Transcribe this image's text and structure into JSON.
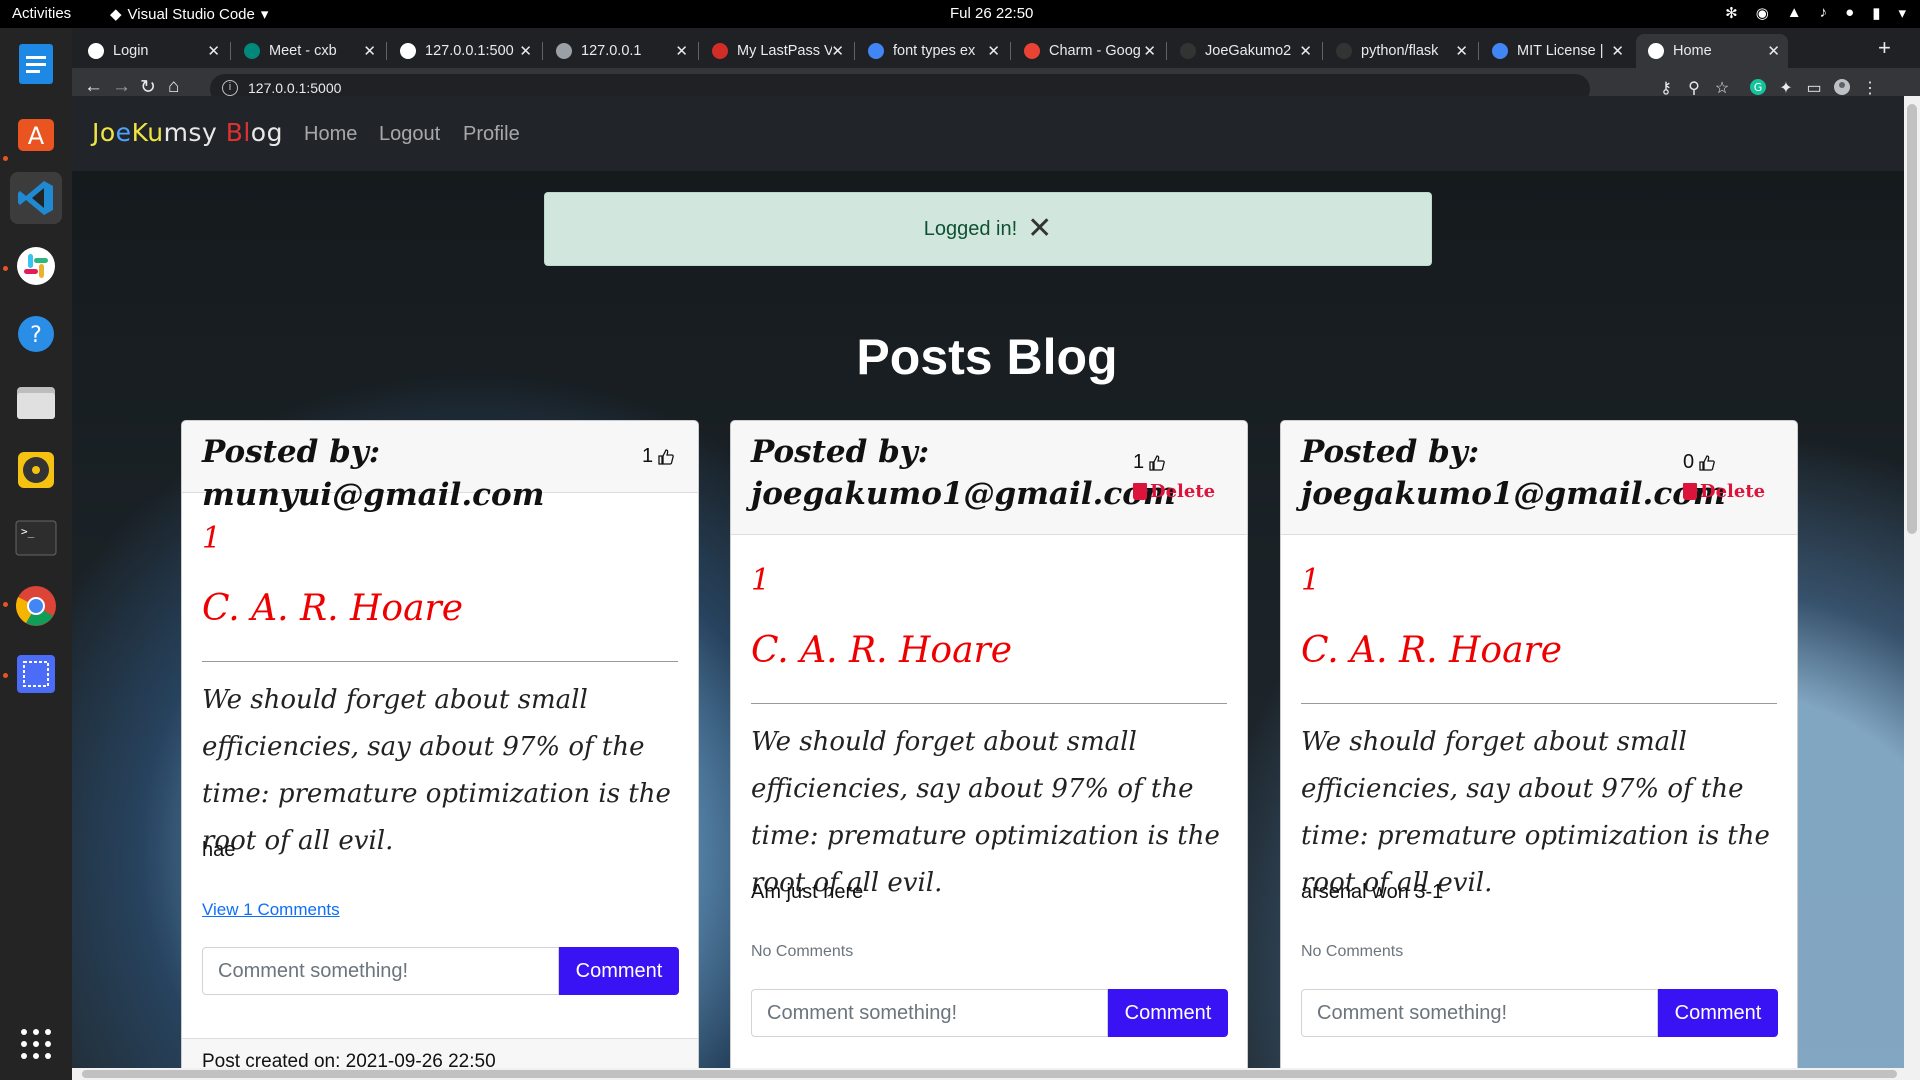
{
  "system": {
    "activities": "Activities",
    "app_menu": "Visual Studio Code",
    "clock": "Ful 26  22:50"
  },
  "browser": {
    "tabs": [
      {
        "label": "Login",
        "fav": "globe-icon",
        "color": "#ffffff"
      },
      {
        "label": "Meet - cxb",
        "fav": "meet-icon",
        "color": "#00897b"
      },
      {
        "label": "127.0.0.1:500",
        "fav": "globe-icon",
        "color": "#ffffff"
      },
      {
        "label": "127.0.0.1",
        "fav": "globe-icon",
        "color": "#9aa0a6"
      },
      {
        "label": "My LastPass V",
        "fav": "lastpass-icon",
        "color": "#d32d27"
      },
      {
        "label": "font types ex",
        "fav": "google-icon",
        "color": "#4285f4"
      },
      {
        "label": "Charm - Goog",
        "fav": "google-fonts-icon",
        "color": "#ea4335"
      },
      {
        "label": "JoeGakumo2",
        "fav": "github-icon",
        "color": "#333333"
      },
      {
        "label": "python/flask",
        "fav": "github-icon",
        "color": "#333333"
      },
      {
        "label": "MIT License |",
        "fav": "question-icon",
        "color": "#4285f4"
      },
      {
        "label": "Home",
        "fav": "globe-icon",
        "color": "#ffffff"
      }
    ],
    "url": "127.0.0.1:5000"
  },
  "site": {
    "brand_parts": [
      {
        "text": "Jo",
        "color": "#f0e442"
      },
      {
        "text": "e",
        "color": "#4fa3ff"
      },
      {
        "text": "Ku",
        "color": "#f0e442"
      },
      {
        "text": "msy ",
        "color": "#e8e8e8"
      },
      {
        "text": "Bl",
        "color": "#e03030"
      },
      {
        "text": "og",
        "color": "#e8e8e8"
      }
    ],
    "nav": {
      "home": "Home",
      "logout": "Logout",
      "profile": "Profile"
    },
    "flash": "Logged in!",
    "page_title": "Posts Blog"
  },
  "posts": [
    {
      "posted_by": "Posted by: munyui@gmail.com",
      "likes": "1",
      "can_delete": false,
      "number": "1",
      "author": "C. A. R. Hoare",
      "quote": "We should forget about small efficiencies, say about 97% of the time: premature optimization is the root of all evil.",
      "body": "hae",
      "comments": "View 1 Comments",
      "comment_placeholder": "Comment something!",
      "comment_button": "Comment",
      "created": "Post created on: 2021-09-26 22:50"
    },
    {
      "posted_by_line1": "Posted by:",
      "posted_by_line2": "joegakumo1@gmail.com",
      "likes": "1",
      "can_delete": true,
      "delete_label": "Delete",
      "number": "1",
      "author": "C. A. R. Hoare",
      "quote": "We should forget about small efficiencies, say about 97% of the time: premature optimization is the root of all evil.",
      "body": "Am just here",
      "comments": "No Comments",
      "comment_placeholder": "Comment something!",
      "comment_button": "Comment"
    },
    {
      "posted_by_line1": "Posted by:",
      "posted_by_line2": "joegakumo1@gmail.com",
      "likes": "0",
      "can_delete": true,
      "delete_label": "Delete",
      "number": "1",
      "author": "C. A. R. Hoare",
      "quote": "We should forget about small efficiencies, say about 97% of the time: premature optimization is the root of all evil.",
      "body": "arsenal won 3-1",
      "comments": "No Comments",
      "comment_placeholder": "Comment something!",
      "comment_button": "Comment"
    }
  ]
}
